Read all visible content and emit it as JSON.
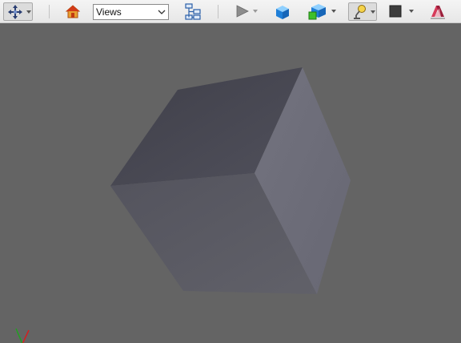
{
  "toolbar": {
    "interaction_icon": "move-cross-icon",
    "home_icon": "home-icon",
    "views_select": {
      "value": "Views"
    },
    "tree_icon": "scene-tree-icon",
    "play_icon": "play-icon",
    "solid_cube_icon": "blue-cube-icon",
    "display_mode_icon": "blue-green-cubes-icon",
    "lighting_icon": "lamp-icon",
    "background_color_icon": "color-square-icon",
    "background_color": "#3c3c3c",
    "clipping_icon": "red-ribbon-icon"
  },
  "viewport": {
    "background_color": "#646464",
    "object": "cube",
    "face_colors": {
      "top": "#4a4a55",
      "front": "#5c5c66",
      "right": "#6e6e7a"
    },
    "axes_indicator": {
      "x_color": "#d42020",
      "y_color": "#20a020",
      "z_color": "#2030d0"
    }
  }
}
